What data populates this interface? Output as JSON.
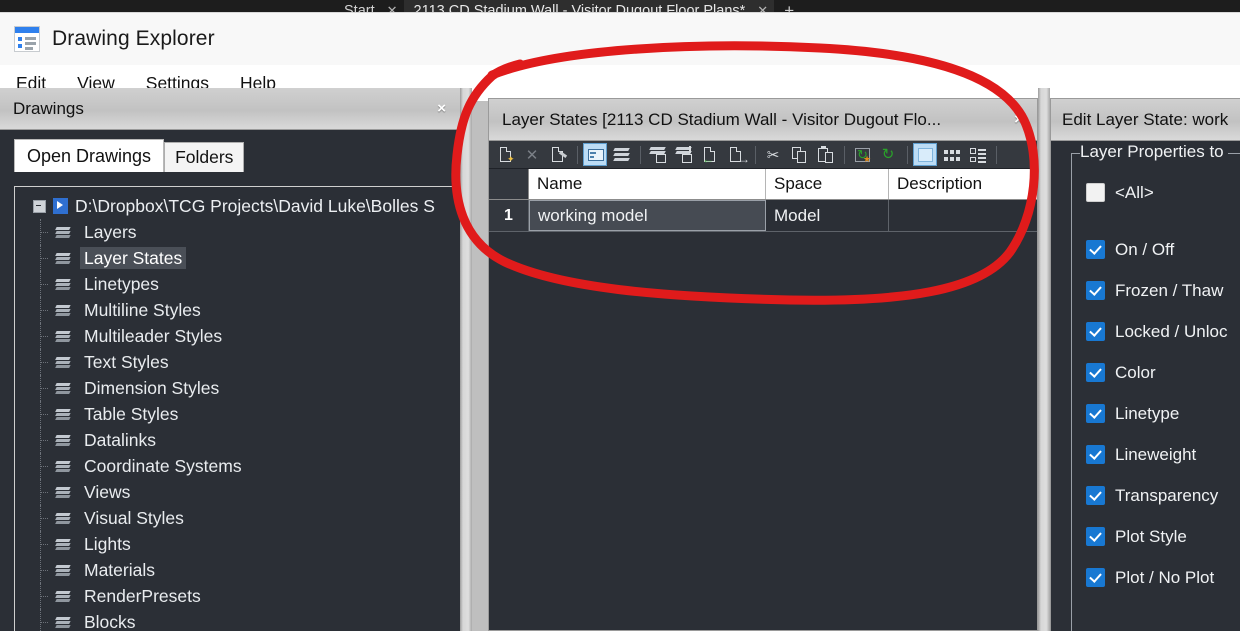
{
  "background_tabs": {
    "items": [
      {
        "label": "Start",
        "close": "✕",
        "active": false
      },
      {
        "label": "2113 CD Stadium Wall - Visitor Dugout Floor Plans*",
        "close": "✕",
        "active": true
      }
    ],
    "new_tab": "+"
  },
  "window": {
    "title": "Drawing Explorer",
    "icon": "document-list-icon"
  },
  "menubar": {
    "items": [
      "Edit",
      "View",
      "Settings",
      "Help"
    ]
  },
  "drawings_panel": {
    "title": "Drawings",
    "close": "×",
    "tabs": [
      {
        "label": "Open Drawings",
        "active": true
      },
      {
        "label": "Folders",
        "active": false
      }
    ],
    "tree": {
      "root": "D:\\Dropbox\\TCG Projects\\David Luke\\Bolles S",
      "root_icon": "dwg-file-icon",
      "items": [
        {
          "label": "Layers",
          "icon": "layers-icon",
          "selected": false
        },
        {
          "label": "Layer States",
          "icon": "layer-states-icon",
          "selected": true
        },
        {
          "label": "Linetypes",
          "icon": "linetypes-icon",
          "selected": false
        },
        {
          "label": "Multiline Styles",
          "icon": "multiline-styles-icon",
          "selected": false
        },
        {
          "label": "Multileader Styles",
          "icon": "multileader-styles-icon",
          "selected": false
        },
        {
          "label": "Text Styles",
          "icon": "text-styles-icon",
          "selected": false
        },
        {
          "label": "Dimension Styles",
          "icon": "dimension-styles-icon",
          "selected": false
        },
        {
          "label": "Table Styles",
          "icon": "table-styles-icon",
          "selected": false
        },
        {
          "label": "Datalinks",
          "icon": "datalinks-icon",
          "selected": false
        },
        {
          "label": "Coordinate Systems",
          "icon": "coordinate-systems-icon",
          "selected": false
        },
        {
          "label": "Views",
          "icon": "views-eye-icon",
          "selected": false
        },
        {
          "label": "Visual Styles",
          "icon": "visual-styles-icon",
          "selected": false
        },
        {
          "label": "Lights",
          "icon": "lights-icon",
          "selected": false
        },
        {
          "label": "Materials",
          "icon": "materials-icon",
          "selected": false
        },
        {
          "label": "RenderPresets",
          "icon": "render-presets-icon",
          "selected": false
        },
        {
          "label": "Blocks",
          "icon": "blocks-icon",
          "selected": false
        }
      ]
    }
  },
  "layer_states_panel": {
    "title": "Layer States [2113 CD Stadium Wall - Visitor Dugout Flo...",
    "close": "×",
    "toolbar": [
      {
        "name": "new-layer-state-button",
        "icon": "page-new-icon"
      },
      {
        "name": "delete-layer-state-button",
        "icon": "close-x-icon",
        "disabled": true
      },
      {
        "name": "purge-layer-state-button",
        "icon": "page-brush-icon"
      },
      {
        "name": "edit-layer-state-button",
        "icon": "properties-panel-icon",
        "active": true
      },
      {
        "name": "select-layers-button",
        "icon": "layers-edit-icon"
      },
      {
        "name": "restore-layer-state-button",
        "icon": "layer-restore-icon"
      },
      {
        "name": "save-layer-state-button",
        "icon": "layer-save-icon"
      },
      {
        "name": "import-layer-state-button",
        "icon": "page-import-icon"
      },
      {
        "name": "export-layer-state-button",
        "icon": "page-export-icon"
      },
      {
        "name": "cut-button",
        "icon": "scissors-icon"
      },
      {
        "name": "copy-button",
        "icon": "copy-icon"
      },
      {
        "name": "paste-button",
        "icon": "paste-icon"
      },
      {
        "name": "refresh-from-drawing-button",
        "icon": "refresh-green-icon"
      },
      {
        "name": "reload-button",
        "icon": "reload-green-icon"
      },
      {
        "name": "view-details-button",
        "icon": "details-view-icon",
        "active": true
      },
      {
        "name": "view-icons-button",
        "icon": "icons-view-icon"
      },
      {
        "name": "view-list-button",
        "icon": "list-view-icon"
      }
    ],
    "table": {
      "columns": [
        "",
        "Name",
        "Space",
        "Description"
      ],
      "rows": [
        {
          "num": "1",
          "name": "working model",
          "space": "Model",
          "description": ""
        }
      ]
    }
  },
  "edit_layer_state_panel": {
    "title": "Edit Layer State: work",
    "group_legend": "Layer Properties to",
    "checkboxes": [
      {
        "label": "<All>",
        "checked": false
      },
      {
        "label": "On / Off",
        "checked": true
      },
      {
        "label": "Frozen / Thaw",
        "checked": true
      },
      {
        "label": "Locked / Unloc",
        "checked": true
      },
      {
        "label": "Color",
        "checked": true
      },
      {
        "label": "Linetype",
        "checked": true
      },
      {
        "label": "Lineweight",
        "checked": true
      },
      {
        "label": "Transparency",
        "checked": true
      },
      {
        "label": "Plot Style",
        "checked": true
      },
      {
        "label": "Plot / No Plot",
        "checked": true
      }
    ]
  },
  "annotation": {
    "type": "hand-drawn-ellipse",
    "color": "#e01b1b",
    "stroke_width": 9
  },
  "colors": {
    "panel_dark": "#2b2f36",
    "accent_blue": "#1878d2",
    "annotation_red": "#e01b1b",
    "title_gray": "#c2c2c2"
  }
}
